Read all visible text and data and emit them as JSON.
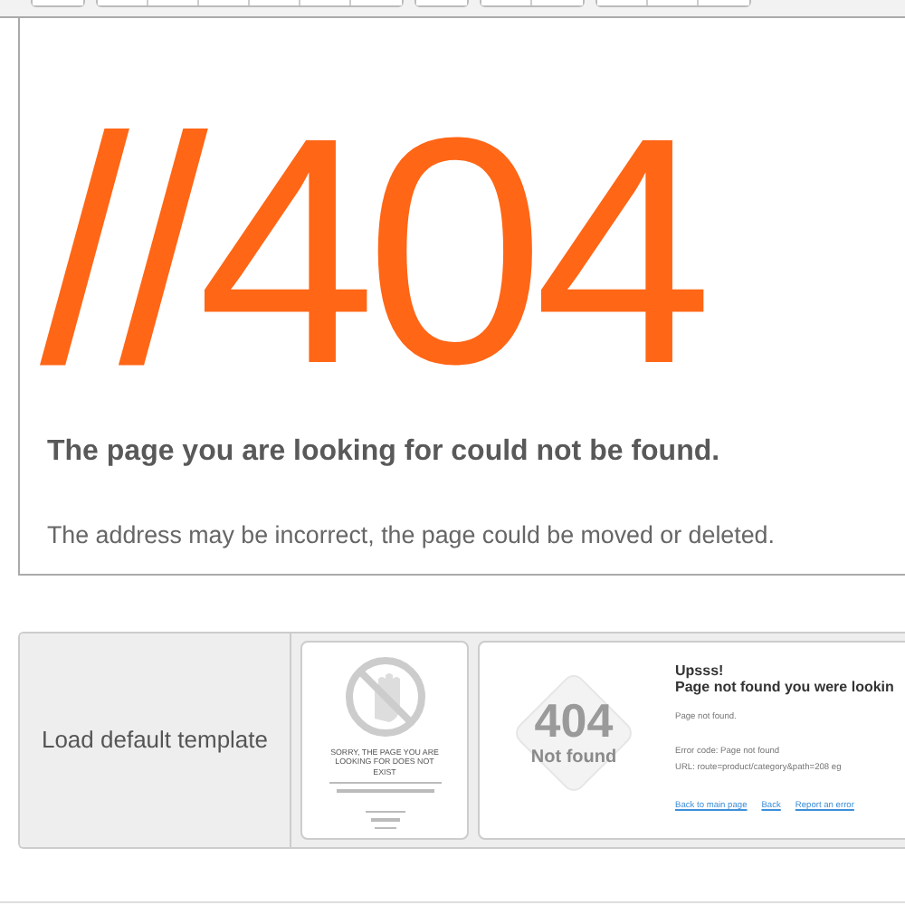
{
  "preview": {
    "code": "//404",
    "heading": "The page you are looking for could not be found.",
    "message": "The address may be incorrect, the page could be moved or deleted."
  },
  "templates": {
    "load_label": "Load default template",
    "items": [
      {
        "kind": "sign",
        "heading": "SORRY, THE PAGE YOU ARE LOOKING FOR DOES NOT EXIST"
      },
      {
        "kind": "diamond",
        "code": "404",
        "caption": "Not found",
        "title": "Upsss!",
        "subtitle": "Page not found you were lookin",
        "text": "Page not found.",
        "error": "Error code: Page not found",
        "url": "URL: route=product/category&path=208 eg",
        "links": [
          "Back to main page",
          "Back",
          "Report an error"
        ]
      }
    ]
  }
}
